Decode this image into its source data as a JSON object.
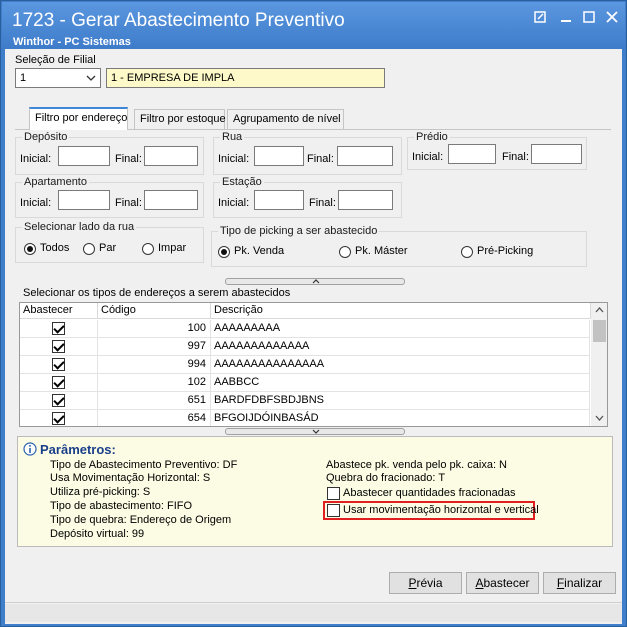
{
  "window": {
    "title": "1723 - Gerar Abastecimento Preventivo",
    "subtitle": "Winthor - PC Sistemas"
  },
  "filial": {
    "label": "Seleção de Filial",
    "code": "1",
    "name": "1 - EMPRESA DE IMPLA"
  },
  "tabs": [
    {
      "label": "Filtro por endereço",
      "active": true
    },
    {
      "label": "Filtro por estoque",
      "active": false
    },
    {
      "label": "Agrupamento de nível",
      "active": false
    }
  ],
  "filters": {
    "deposito": {
      "label": "Depósito",
      "inicial": "Inicial:",
      "final": "Final:"
    },
    "rua": {
      "label": "Rua",
      "inicial": "Inicial:",
      "final": "Final:"
    },
    "predio": {
      "label": "Prédio",
      "inicial": "Inicial:",
      "final": "Final:"
    },
    "apartamento": {
      "label": "Apartamento",
      "inicial": "Inicial:",
      "final": "Final:"
    },
    "estacao": {
      "label": "Estação",
      "inicial": "Inicial:",
      "final": "Final:"
    }
  },
  "lado_rua": {
    "label": "Selecionar lado da rua",
    "options": [
      "Todos",
      "Par",
      "Impar"
    ],
    "selected": "Todos"
  },
  "picking": {
    "label": "Tipo de picking a ser abastecido",
    "options": [
      "Pk. Venda",
      "Pk. Máster",
      "Pré-Picking"
    ],
    "selected": "Pk. Venda"
  },
  "grid": {
    "label": "Selecionar os tipos de endereços a serem abastecidos",
    "columns": [
      "Abastecer",
      "Código",
      "Descrição"
    ],
    "rows": [
      {
        "checked": true,
        "codigo": "100",
        "descricao": "AAAAAAAAA"
      },
      {
        "checked": true,
        "codigo": "997",
        "descricao": "AAAAAAAAAAAAA"
      },
      {
        "checked": true,
        "codigo": "994",
        "descricao": "AAAAAAAAAAAAAAA"
      },
      {
        "checked": true,
        "codigo": "102",
        "descricao": "AABBCC"
      },
      {
        "checked": true,
        "codigo": "651",
        "descricao": "BARDFDBFSBDJBNS"
      },
      {
        "checked": true,
        "codigo": "654",
        "descricao": "BFGOIJDÓINBASÁD"
      }
    ]
  },
  "params": {
    "title": "Parâmetros:",
    "left": [
      "Tipo de Abastecimento Preventivo: DF",
      "Usa Movimentação Horizontal: S",
      "Utiliza pré-picking: S",
      "Tipo de abastecimento: FIFO",
      "Tipo de quebra: Endereço de Origem",
      "Depósito virtual: 99"
    ],
    "right": [
      "Abastece pk. venda pelo pk. caixa: N",
      "Quebra do fracionado: T"
    ],
    "check_fracionadas": "Abastecer quantidades fracionadas",
    "check_movimentacao": "Usar movimentação horizontal e vertical",
    "highlight_color": "#e02020"
  },
  "buttons": {
    "previa_key": "P",
    "previa_rest": "révia",
    "abastecer_key": "A",
    "abastecer_rest": "bastecer",
    "finalizar_key": "F",
    "finalizar_rest": "inalizar"
  }
}
